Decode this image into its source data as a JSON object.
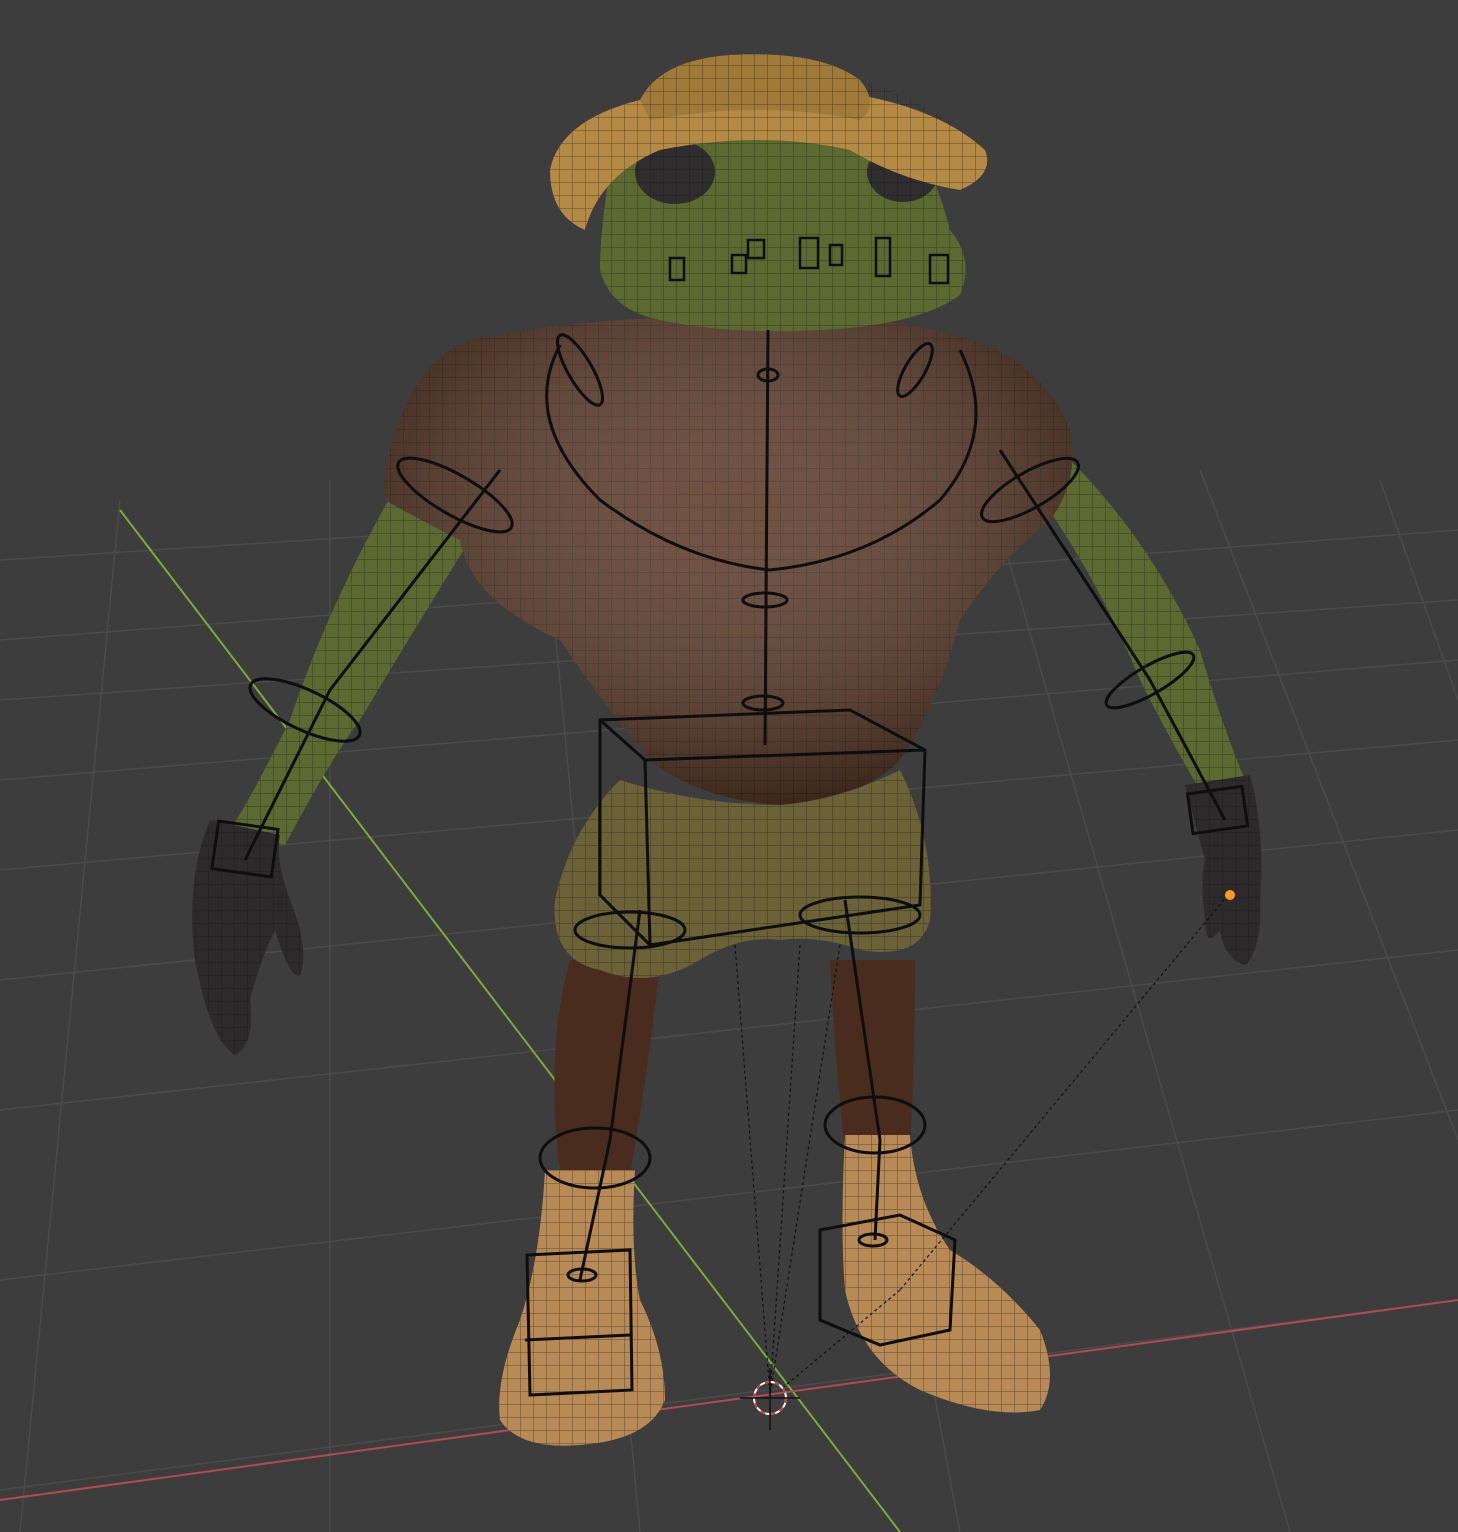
{
  "viewport": {
    "background": "#3d3d3d",
    "grid_color": "#4a4a4a",
    "x_axis_color": "#b04a55",
    "y_axis_color": "#7fa83a"
  },
  "model": {
    "character": "frog",
    "skin_color": "#5c6a32",
    "shirt_color": "#5e3d2b",
    "hat_color": "#b58a45",
    "boot_color": "#b88a56",
    "glove_color": "#2d2a2b",
    "wire_color": "#151515"
  },
  "icons": {
    "cursor": "3d-cursor-icon",
    "origin": "object-origin-icon"
  },
  "colors": {
    "origin_dot": "#ff9a1a",
    "cursor_ring": "#ffffff",
    "cursor_dash": "#d23a3a"
  }
}
